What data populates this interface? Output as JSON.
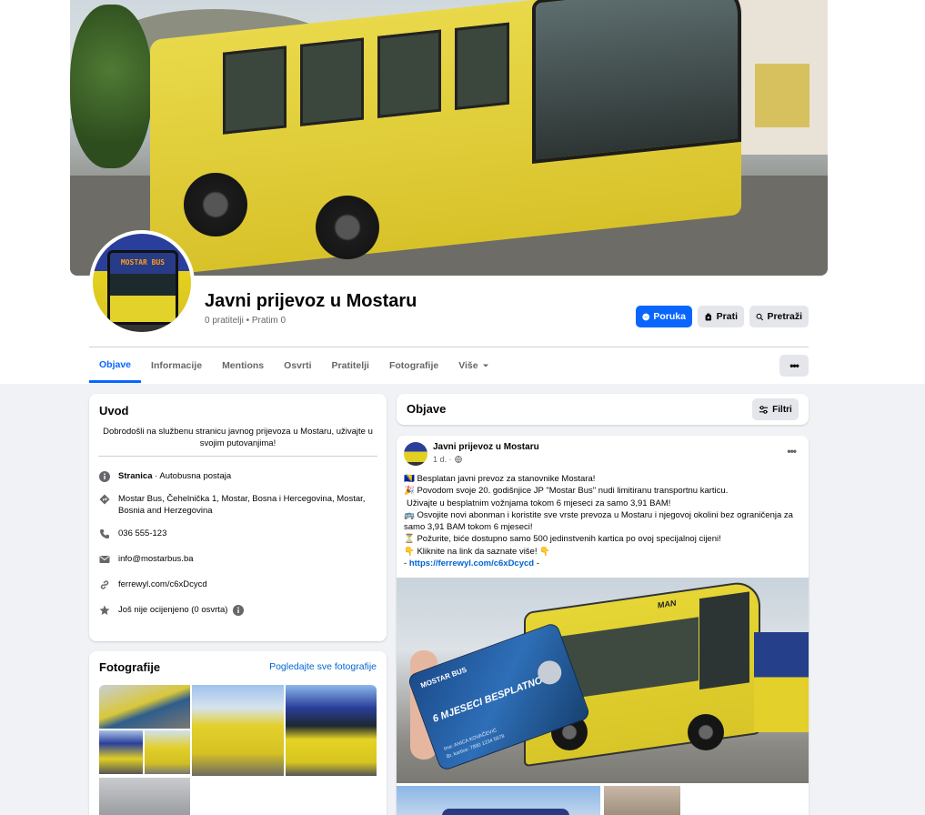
{
  "page": {
    "name": "Javni prijevoz u Mostaru",
    "stats": "0 pratitelji • Pratim 0",
    "avatar_sign": "MOSTAR BUS"
  },
  "actions": {
    "message": "Poruka",
    "follow": "Prati",
    "search": "Pretraži"
  },
  "tabs": [
    {
      "label": "Objave",
      "active": true
    },
    {
      "label": "Informacije"
    },
    {
      "label": "Mentions"
    },
    {
      "label": "Osvrti"
    },
    {
      "label": "Pratitelji"
    },
    {
      "label": "Fotografije"
    },
    {
      "label": "Više"
    }
  ],
  "intro": {
    "title": "Uvod",
    "bio": "Dobrodošli na službenu stranicu javnog prijevoza u Mostaru, uživajte u svojim putovanjima!",
    "category_bold": "Stranica",
    "category_rest": " · Autobusna postaja",
    "address": "Mostar Bus, Čehelnička 1, Mostar, Bosna i Hercegovina, Mostar, Bosnia and Herzegovina",
    "phone": "036 555-123",
    "email": "info@mostarbus.ba",
    "website": "ferrewyl.com/c6xDcycd",
    "rating": "Još nije ocijenjeno (0 osvrta)"
  },
  "photos": {
    "title": "Fotografije",
    "see_all": "Pogledajte sve fotografije"
  },
  "posts": {
    "title": "Objave",
    "filters": "Filtri",
    "items": [
      {
        "author": "Javni prijevoz u Mostaru",
        "time": "1 d. ·",
        "lines": [
          "🇧🇦 Besplatan javni prevoz za stanovnike Mostara!",
          "🎉 Povodom svoje 20. godišnjice JP \"Mostar Bus\" nudi limitiranu transportnu karticu.",
          "Uživajte u besplatnim vožnjama tokom 6 mjeseci za samo 3,91 BAM!",
          "🚌 Osvojite novi abonman i koristite sve vrste prevoza u Mostaru i njegovoj okolini bez ograničenja za samo 3,91 BAM tokom 6 mjeseci!",
          "⏳ Požurite, biće dostupno samo 500 jedinstvenih kartica po ovoj specijalnoj cijeni!",
          "👇 Kliknite na link da saznate više! 👇"
        ],
        "link_prefix": "- ",
        "link": "https://ferrewyl.com/c6xDcycd",
        "link_suffix": " -",
        "card_brand": "MOSTAR BUS",
        "card_text": "6 MJESECI BESPLATNO",
        "card_name": "Ime: ANICA KOVAČEVIĆ",
        "card_number": "Br. kartice: 7890 1234 5678",
        "bus_brand": "MAN"
      }
    ]
  }
}
